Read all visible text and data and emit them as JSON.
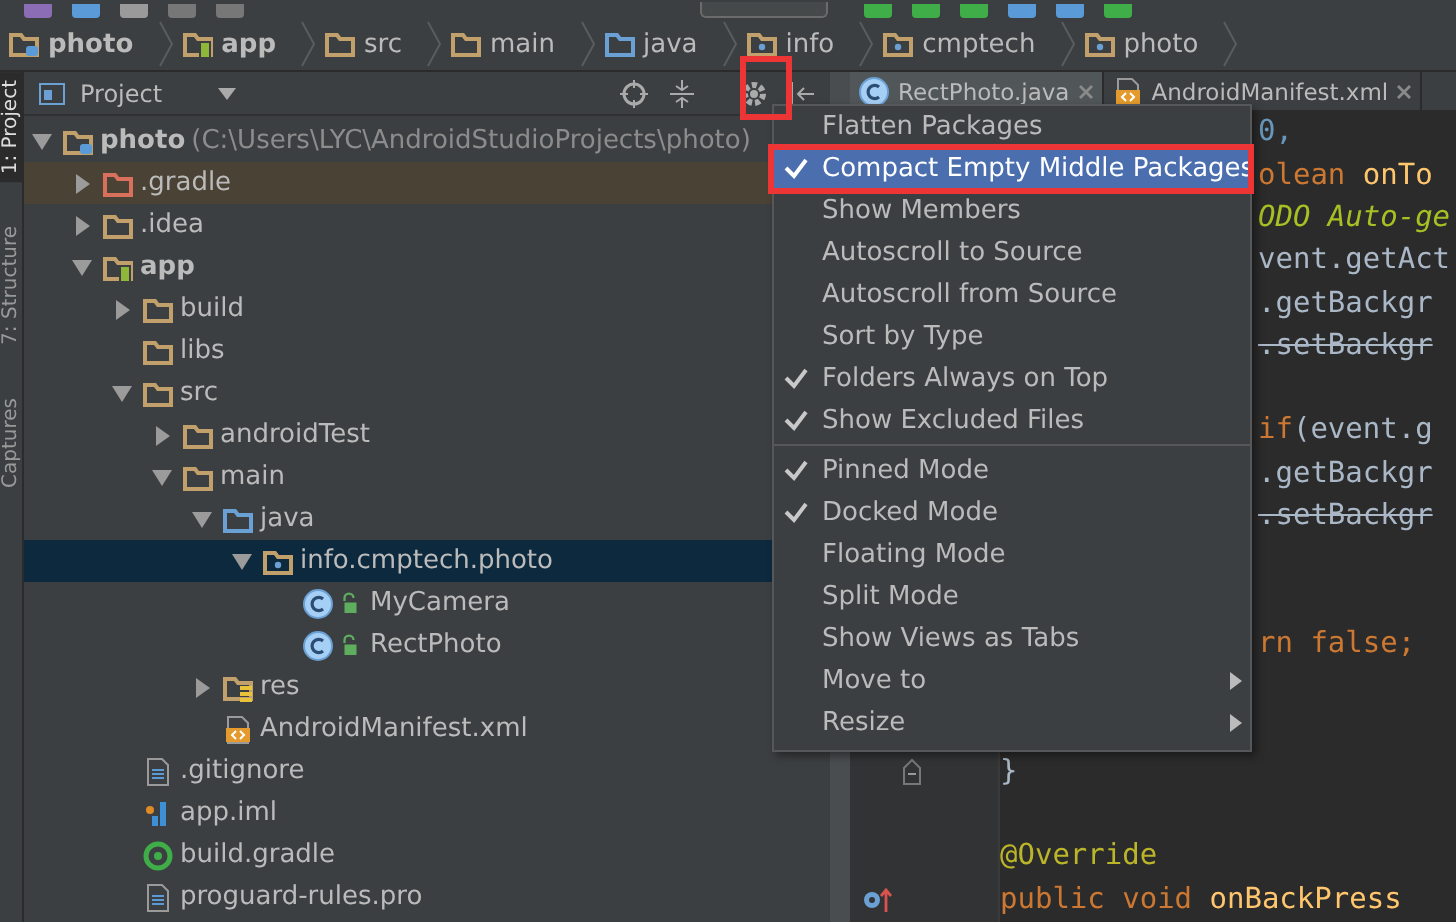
{
  "breadcrumbs": [
    {
      "label": "photo",
      "kind": "project",
      "bold": true
    },
    {
      "label": "app",
      "kind": "module",
      "bold": true
    },
    {
      "label": "src",
      "kind": "folder",
      "bold": false
    },
    {
      "label": "main",
      "kind": "folder",
      "bold": false
    },
    {
      "label": "java",
      "kind": "source",
      "bold": false
    },
    {
      "label": "info",
      "kind": "package",
      "bold": false
    },
    {
      "label": "cmptech",
      "kind": "package",
      "bold": false
    },
    {
      "label": "photo",
      "kind": "package",
      "bold": false
    }
  ],
  "side_tabs": [
    {
      "label": "1: Project",
      "selected": true
    },
    {
      "label": "7: Structure",
      "selected": false
    },
    {
      "label": "Captures",
      "selected": false
    }
  ],
  "project_panel": {
    "title": "Project",
    "tree": [
      {
        "label": "photo",
        "path": "(C:\\Users\\LYC\\AndroidStudioProjects\\photo)",
        "kind": "project",
        "bold": true,
        "expanded": true,
        "selected": false,
        "children": [
          {
            "label": ".gradle",
            "kind": "excluded",
            "expanded": false,
            "selected": false
          },
          {
            "label": ".idea",
            "kind": "folder",
            "expanded": false,
            "selected": false
          },
          {
            "label": "app",
            "kind": "module",
            "bold": true,
            "expanded": true,
            "selected": false,
            "children": [
              {
                "label": "build",
                "kind": "folder",
                "expanded": false,
                "selected": false
              },
              {
                "label": "libs",
                "kind": "folder",
                "selected": false
              },
              {
                "label": "src",
                "kind": "folder",
                "expanded": true,
                "selected": false,
                "children": [
                  {
                    "label": "androidTest",
                    "kind": "folder",
                    "expanded": false,
                    "selected": false
                  },
                  {
                    "label": "main",
                    "kind": "folder",
                    "expanded": true,
                    "selected": false,
                    "children": [
                      {
                        "label": "java",
                        "kind": "source",
                        "expanded": true,
                        "selected": false,
                        "children": [
                          {
                            "label": "info.cmptech.photo",
                            "kind": "package",
                            "expanded": true,
                            "selected": true,
                            "children": [
                              {
                                "label": "MyCamera",
                                "kind": "class",
                                "selected": false
                              },
                              {
                                "label": "RectPhoto",
                                "kind": "class",
                                "selected": false
                              }
                            ]
                          }
                        ]
                      },
                      {
                        "label": "res",
                        "kind": "res",
                        "expanded": false,
                        "selected": false
                      },
                      {
                        "label": "AndroidManifest.xml",
                        "kind": "manifest",
                        "selected": false
                      }
                    ]
                  }
                ]
              },
              {
                "label": ".gitignore",
                "kind": "text",
                "selected": false
              },
              {
                "label": "app.iml",
                "kind": "iml",
                "selected": false
              },
              {
                "label": "build.gradle",
                "kind": "gradle",
                "selected": false
              },
              {
                "label": "proguard-rules.pro",
                "kind": "text",
                "selected": false
              }
            ]
          }
        ]
      }
    ]
  },
  "editor": {
    "tabs": [
      {
        "label": "RectPhoto.java",
        "kind": "class",
        "selected": true
      },
      {
        "label": "AndroidManifest.xml",
        "kind": "manifest",
        "selected": false
      }
    ],
    "lines": [
      {
        "kind": "clipped",
        "segments": [
          {
            "text": "0,",
            "kind": "number"
          }
        ]
      },
      {
        "kind": "clipped",
        "segments": [
          {
            "text": "olean ",
            "kind": "keyword"
          },
          {
            "text": "onTo",
            "kind": "method"
          }
        ]
      },
      {
        "kind": "clipped",
        "segments": [
          {
            "text": "ODO Auto-ge",
            "kind": "todo"
          }
        ]
      },
      {
        "kind": "clipped",
        "segments": [
          {
            "text": "vent.getAct",
            "kind": "plain"
          }
        ]
      },
      {
        "kind": "clipped",
        "segments": [
          {
            "text": ".getBackgr",
            "kind": "plain"
          }
        ]
      },
      {
        "kind": "clipped",
        "segments": [
          {
            "text": ".setBackgr",
            "kind": "deprecated"
          }
        ]
      },
      {
        "kind": "blank"
      },
      {
        "kind": "clipped",
        "segments": [
          {
            "text": "if",
            "kind": "keyword"
          },
          {
            "text": "(event.g",
            "kind": "plain"
          }
        ]
      },
      {
        "kind": "clipped",
        "segments": [
          {
            "text": ".getBackgr",
            "kind": "plain"
          }
        ]
      },
      {
        "kind": "clipped",
        "segments": [
          {
            "text": ".setBackgr",
            "kind": "deprecated"
          }
        ]
      },
      {
        "kind": "blank"
      },
      {
        "kind": "blank"
      },
      {
        "kind": "clipped",
        "segments": [
          {
            "text": "rn false;",
            "kind": "keyword"
          }
        ]
      },
      {
        "kind": "blank"
      },
      {
        "kind": "blank"
      },
      {
        "kind": "fold",
        "segments": [
          {
            "text": "}",
            "kind": "plain"
          }
        ]
      },
      {
        "kind": "blank"
      },
      {
        "kind": "full",
        "segments": [
          {
            "text": "@Override",
            "kind": "annotation"
          }
        ]
      },
      {
        "kind": "override",
        "segments": [
          {
            "text": "public void ",
            "kind": "keyword"
          },
          {
            "text": "onBackPress",
            "kind": "method"
          }
        ]
      }
    ]
  },
  "menu": {
    "sections": [
      {
        "items": [
          {
            "label": "Flatten Packages",
            "checked": false,
            "selected": false
          },
          {
            "label": "Compact Empty Middle Packages",
            "checked": true,
            "selected": true
          },
          {
            "label": "Show Members",
            "checked": false,
            "selected": false
          },
          {
            "label": "Autoscroll to Source",
            "checked": false,
            "selected": false
          },
          {
            "label": "Autoscroll from Source",
            "checked": false,
            "selected": false
          },
          {
            "label": "Sort by Type",
            "checked": false,
            "selected": false
          },
          {
            "label": "Folders Always on Top",
            "checked": true,
            "selected": false
          },
          {
            "label": "Show Excluded Files",
            "checked": true,
            "selected": false
          }
        ]
      },
      {
        "items": [
          {
            "label": "Pinned Mode",
            "checked": true,
            "selected": false
          },
          {
            "label": "Docked Mode",
            "checked": true,
            "selected": false
          },
          {
            "label": "Floating Mode",
            "checked": false,
            "selected": false
          },
          {
            "label": "Split Mode",
            "checked": false,
            "selected": false
          },
          {
            "label": "Show Views as Tabs",
            "checked": false,
            "selected": false
          },
          {
            "label": "Move to",
            "checked": false,
            "selected": false,
            "submenu": true
          },
          {
            "label": "Resize",
            "checked": false,
            "selected": false,
            "submenu": true
          }
        ]
      }
    ]
  }
}
